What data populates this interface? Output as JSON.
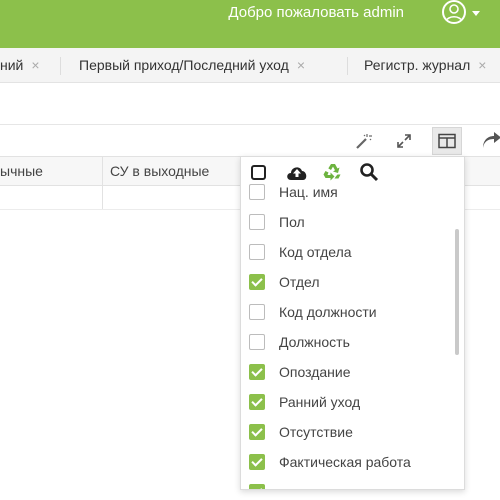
{
  "header": {
    "welcome_text": "Добро пожаловать admin",
    "accent_color": "#8cc04b",
    "avatar_icon": "user-avatar-icon"
  },
  "tabs": [
    {
      "label": "ний",
      "close": "×"
    },
    {
      "label": "Первый приход/Последний уход",
      "close": "×"
    },
    {
      "label": "Регистр. журнал",
      "close": "×"
    }
  ],
  "toolbar": {
    "icons": [
      "magic-wand-icon",
      "expand-icon",
      "columns-icon",
      "share-icon"
    ]
  },
  "grid": {
    "columns": [
      "ычные",
      "СУ в выходные"
    ]
  },
  "column_panel": {
    "tool_icons": [
      "select-all-checkbox-icon",
      "cloud-upload-icon",
      "recycle-icon",
      "search-icon"
    ],
    "items": [
      {
        "label": "Нац. имя",
        "checked": false
      },
      {
        "label": "Пол",
        "checked": false
      },
      {
        "label": "Код отдела",
        "checked": false
      },
      {
        "label": "Отдел",
        "checked": true
      },
      {
        "label": "Код должности",
        "checked": false
      },
      {
        "label": "Должность",
        "checked": false
      },
      {
        "label": "Опоздание",
        "checked": true
      },
      {
        "label": "Ранний уход",
        "checked": true
      },
      {
        "label": "Отсутствие",
        "checked": true
      },
      {
        "label": "Фактическая работа",
        "checked": true
      },
      {
        "label": "",
        "checked": true
      }
    ]
  }
}
